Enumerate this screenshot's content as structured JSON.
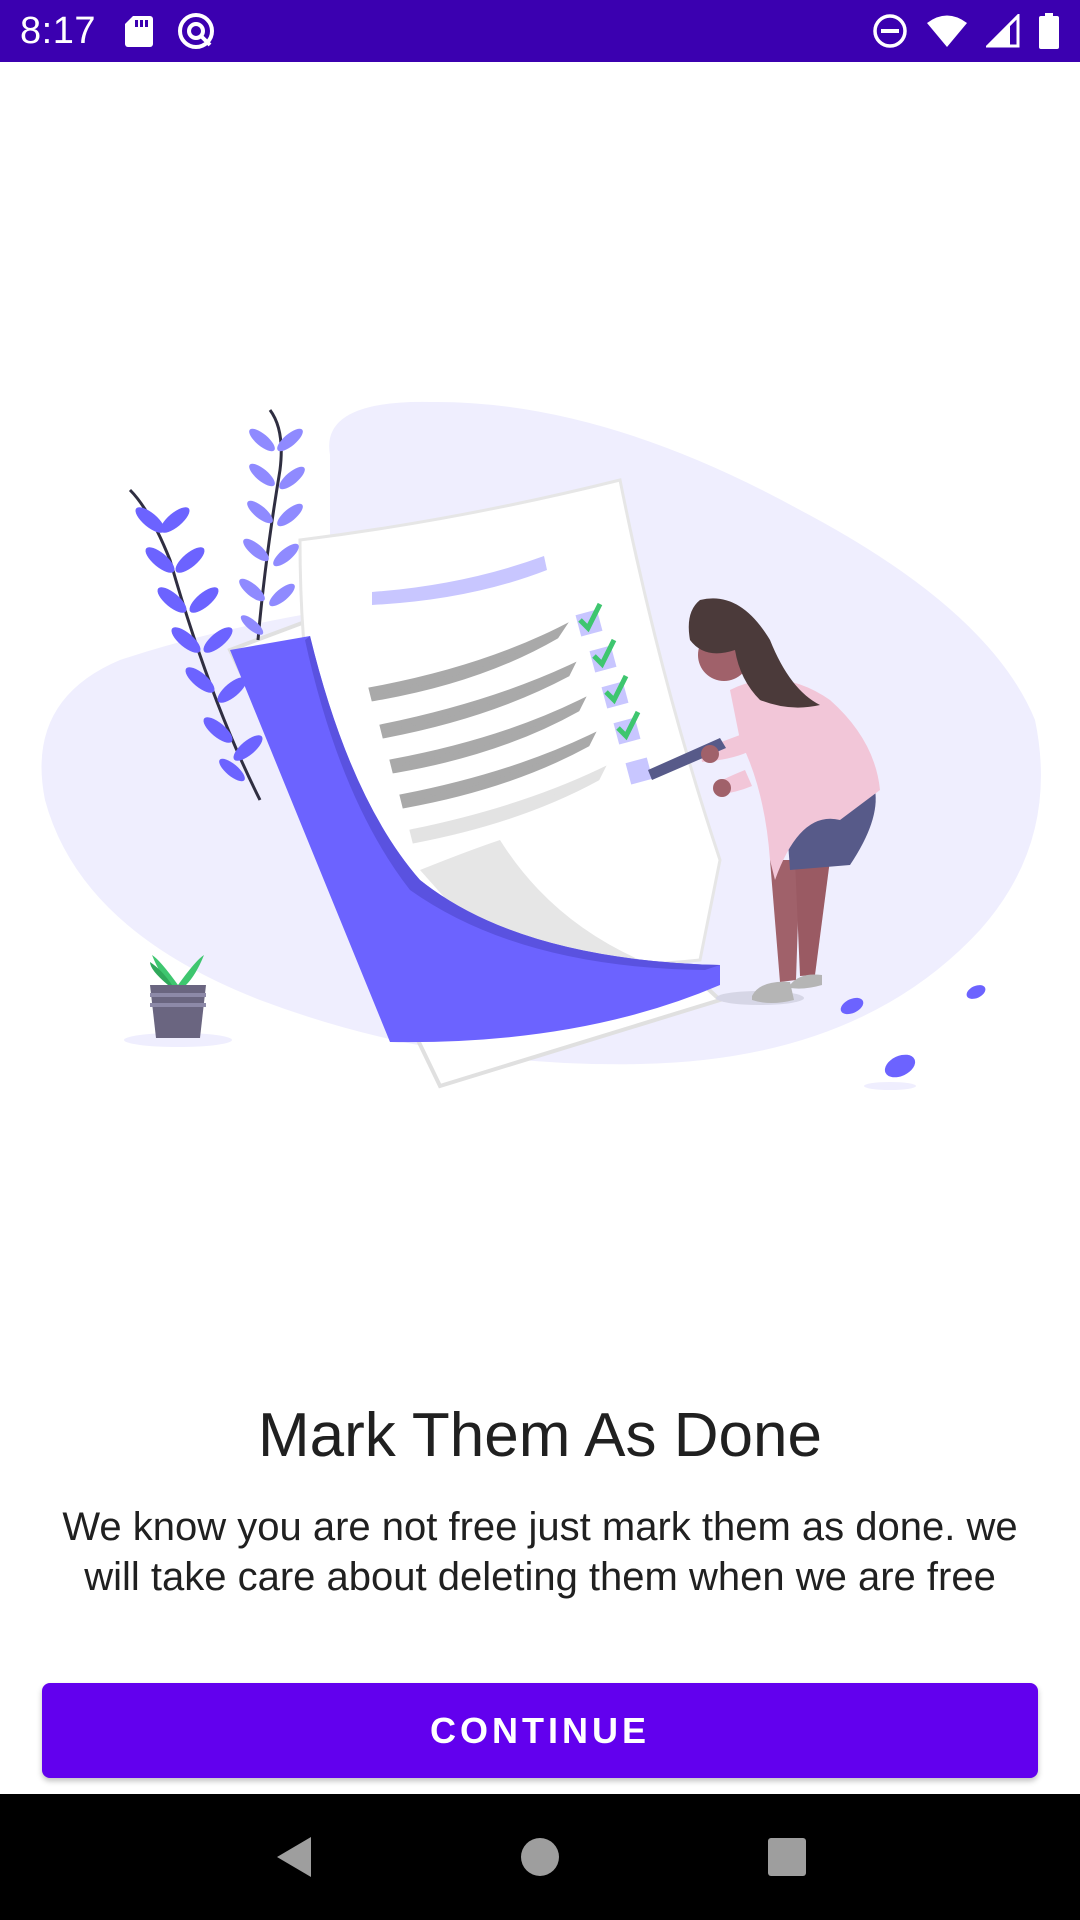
{
  "status_bar": {
    "time": "8:17",
    "left_icons": [
      "sd-card-icon",
      "sync-icon"
    ],
    "right_icons": [
      "do-not-disturb-icon",
      "wifi-icon",
      "signal-icon",
      "battery-icon"
    ]
  },
  "onboarding": {
    "title": "Mark Them As Done",
    "description": "We know you are not free just mark them as done. we will take care about deleting them when we are free",
    "continue_label": "CONTINUE"
  },
  "nav_bar": {
    "buttons": [
      "back-icon",
      "home-icon",
      "recents-icon"
    ]
  },
  "colors": {
    "status_bar": "#3b00b0",
    "accent": "#6200ee",
    "illustration_primary": "#6c63ff",
    "checkmark": "#3ec66f"
  }
}
